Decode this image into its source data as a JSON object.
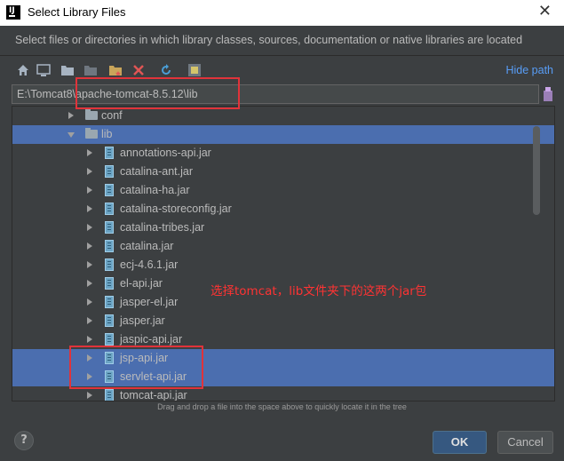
{
  "window": {
    "title": "Select Library Files",
    "close_glyph": "✕"
  },
  "description": "Select files or directories in which library classes, sources, documentation or native libraries are located",
  "toolbar": {
    "icons": [
      "home-icon",
      "desktop-icon",
      "project-icon",
      "module-icon",
      "new-folder-icon",
      "delete-icon",
      "refresh-icon",
      "show-hidden-icon"
    ],
    "hide_path_label": "Hide path"
  },
  "path": {
    "value": "E:\\Tomcat8\\apache-tomcat-8.5.12\\lib"
  },
  "tree": {
    "items": [
      {
        "label": "conf",
        "type": "folder",
        "expanded": false,
        "selected": false
      },
      {
        "label": "lib",
        "type": "folder",
        "expanded": true,
        "selected": true
      },
      {
        "label": "annotations-api.jar",
        "type": "jar",
        "selected": false
      },
      {
        "label": "catalina-ant.jar",
        "type": "jar",
        "selected": false
      },
      {
        "label": "catalina-ha.jar",
        "type": "jar",
        "selected": false
      },
      {
        "label": "catalina-storeconfig.jar",
        "type": "jar",
        "selected": false
      },
      {
        "label": "catalina-tribes.jar",
        "type": "jar",
        "selected": false
      },
      {
        "label": "catalina.jar",
        "type": "jar",
        "selected": false
      },
      {
        "label": "ecj-4.6.1.jar",
        "type": "jar",
        "selected": false
      },
      {
        "label": "el-api.jar",
        "type": "jar",
        "selected": false
      },
      {
        "label": "jasper-el.jar",
        "type": "jar",
        "selected": false
      },
      {
        "label": "jasper.jar",
        "type": "jar",
        "selected": false
      },
      {
        "label": "jaspic-api.jar",
        "type": "jar",
        "selected": false
      },
      {
        "label": "jsp-api.jar",
        "type": "jar",
        "selected": true
      },
      {
        "label": "servlet-api.jar",
        "type": "jar",
        "selected": true
      },
      {
        "label": "tomcat-api.jar",
        "type": "jar",
        "selected": false
      }
    ]
  },
  "hint": "Drag and drop a file into the space above to quickly locate it in the tree",
  "annotation": {
    "text": "选择tomcat，lib文件夹下的这两个jar包",
    "color": "#ff3333"
  },
  "buttons": {
    "help": "?",
    "ok": "OK",
    "cancel": "Cancel"
  },
  "colors": {
    "selection": "#4b6eaf",
    "link": "#589df6",
    "background": "#3c3f41"
  }
}
